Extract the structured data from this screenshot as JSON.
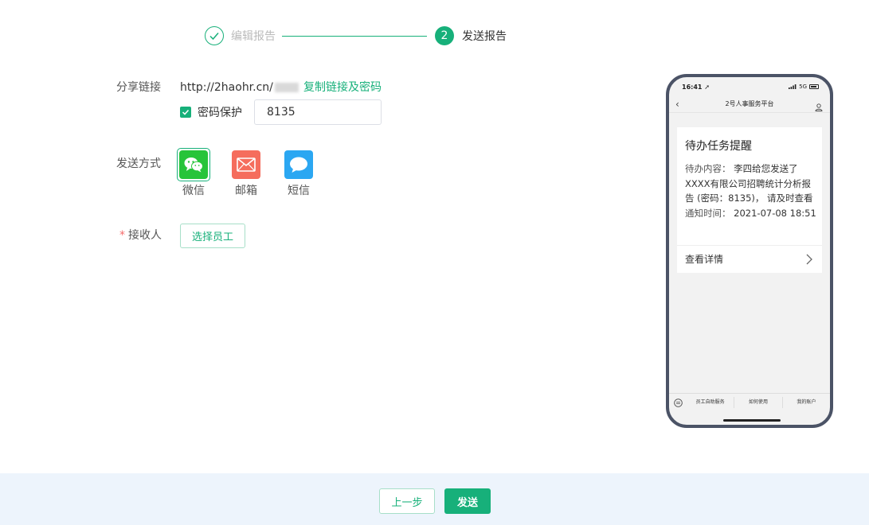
{
  "steps": [
    {
      "label": "编辑报告",
      "state": "done"
    },
    {
      "label": "发送报告",
      "state": "active",
      "number": "2"
    }
  ],
  "share": {
    "label": "分享链接",
    "url": "http://2haohr.cn/",
    "copy_label": "复制链接及密码"
  },
  "password": {
    "checkbox_label": "密码保护",
    "checked": true,
    "value": "8135"
  },
  "send_method": {
    "label": "发送方式",
    "options": [
      {
        "name": "微信",
        "icon": "wechat-icon",
        "color": "#27c43a",
        "selected": true
      },
      {
        "name": "邮箱",
        "icon": "mail-icon",
        "color": "#f56d5d",
        "selected": false
      },
      {
        "name": "短信",
        "icon": "sms-icon",
        "color": "#2ba7f2",
        "selected": false
      }
    ]
  },
  "recipient": {
    "required_mark": "*",
    "label": "接收人",
    "button_label": "选择员工"
  },
  "phone": {
    "time": "16:41",
    "network": "5G",
    "title": "2号人事服务平台",
    "card": {
      "title": "待办任务提醒",
      "content_label": "待办内容：",
      "content_value": "李四给您发送了XXXX有限公司招聘统计分析报告 (密码：8135)， 请及时查看",
      "time_label": "通知时间：",
      "time_value": "2021-07-08 18:51",
      "detail_label": "查看详情"
    },
    "tabs": [
      "员工自助服务",
      "如何使用",
      "我的账户"
    ]
  },
  "footer": {
    "prev_label": "上一步",
    "send_label": "发送"
  },
  "colors": {
    "primary": "#17b07a",
    "footer_bg": "#edf4fc",
    "phone_frame": "#4b5366"
  }
}
